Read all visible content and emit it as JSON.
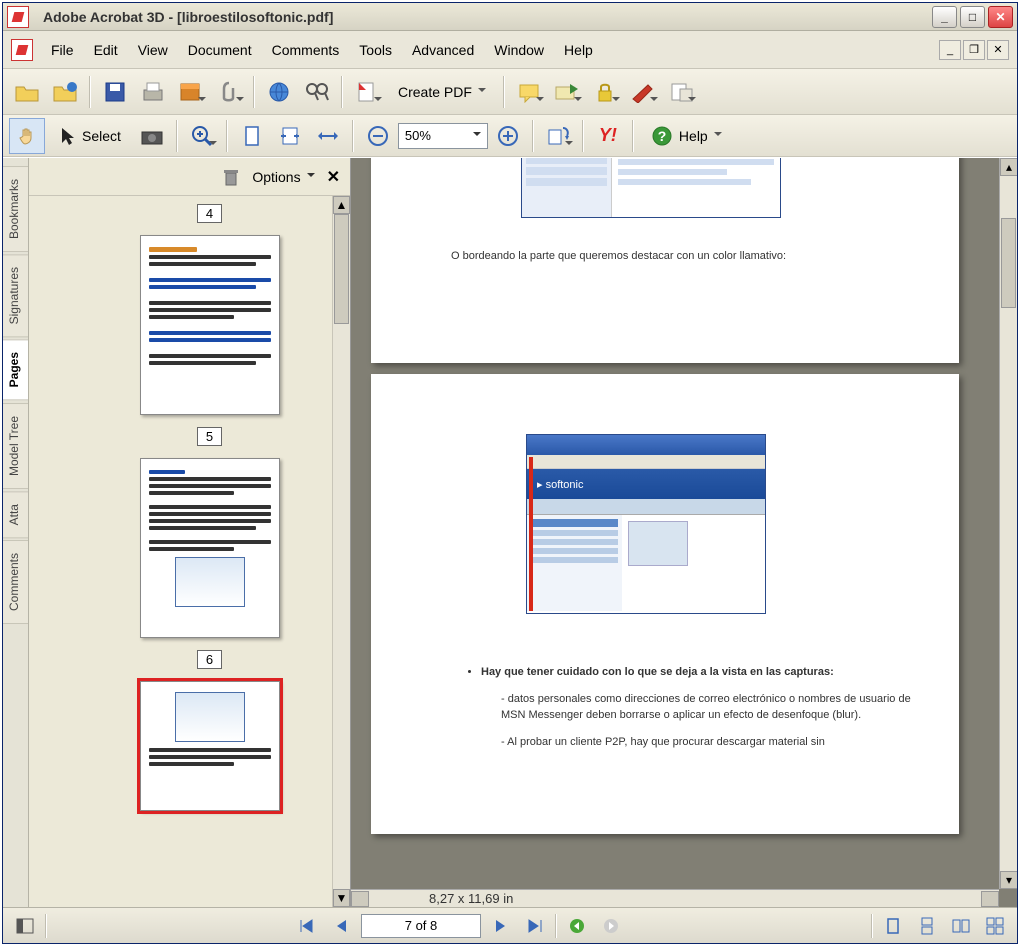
{
  "window_title": "Adobe Acrobat 3D - [libroestilosoftonic.pdf]",
  "menu": [
    "File",
    "Edit",
    "View",
    "Document",
    "Comments",
    "Tools",
    "Advanced",
    "Window",
    "Help"
  ],
  "toolbar": {
    "create_pdf": "Create PDF",
    "select": "Select",
    "zoom_value": "50%",
    "help": "Help",
    "yahoo": "Y!"
  },
  "navpane": {
    "options": "Options",
    "tabs": [
      "Bookmarks",
      "Signatures",
      "Pages",
      "Model Tree",
      "Atta",
      "Comments"
    ],
    "active_tab": 2,
    "thumbs": [
      {
        "label": "4"
      },
      {
        "label": "5"
      },
      {
        "label": "6"
      }
    ]
  },
  "document": {
    "dimension_label": "8,27 x 11,69 in",
    "page_counter": "7 of 8",
    "page1_text": "O bordeando la parte que queremos destacar con un color llamativo:",
    "page2_bullet": "Hay que tener cuidado con lo que se deja a la vista en las capturas:",
    "page2_sub1": "datos personales como direcciones de correo electrónico o nombres de usuario de MSN Messenger deben borrarse o aplicar un efecto de desenfoque (blur).",
    "page2_sub2": "Al probar un cliente P2P, hay que procurar descargar material sin"
  }
}
